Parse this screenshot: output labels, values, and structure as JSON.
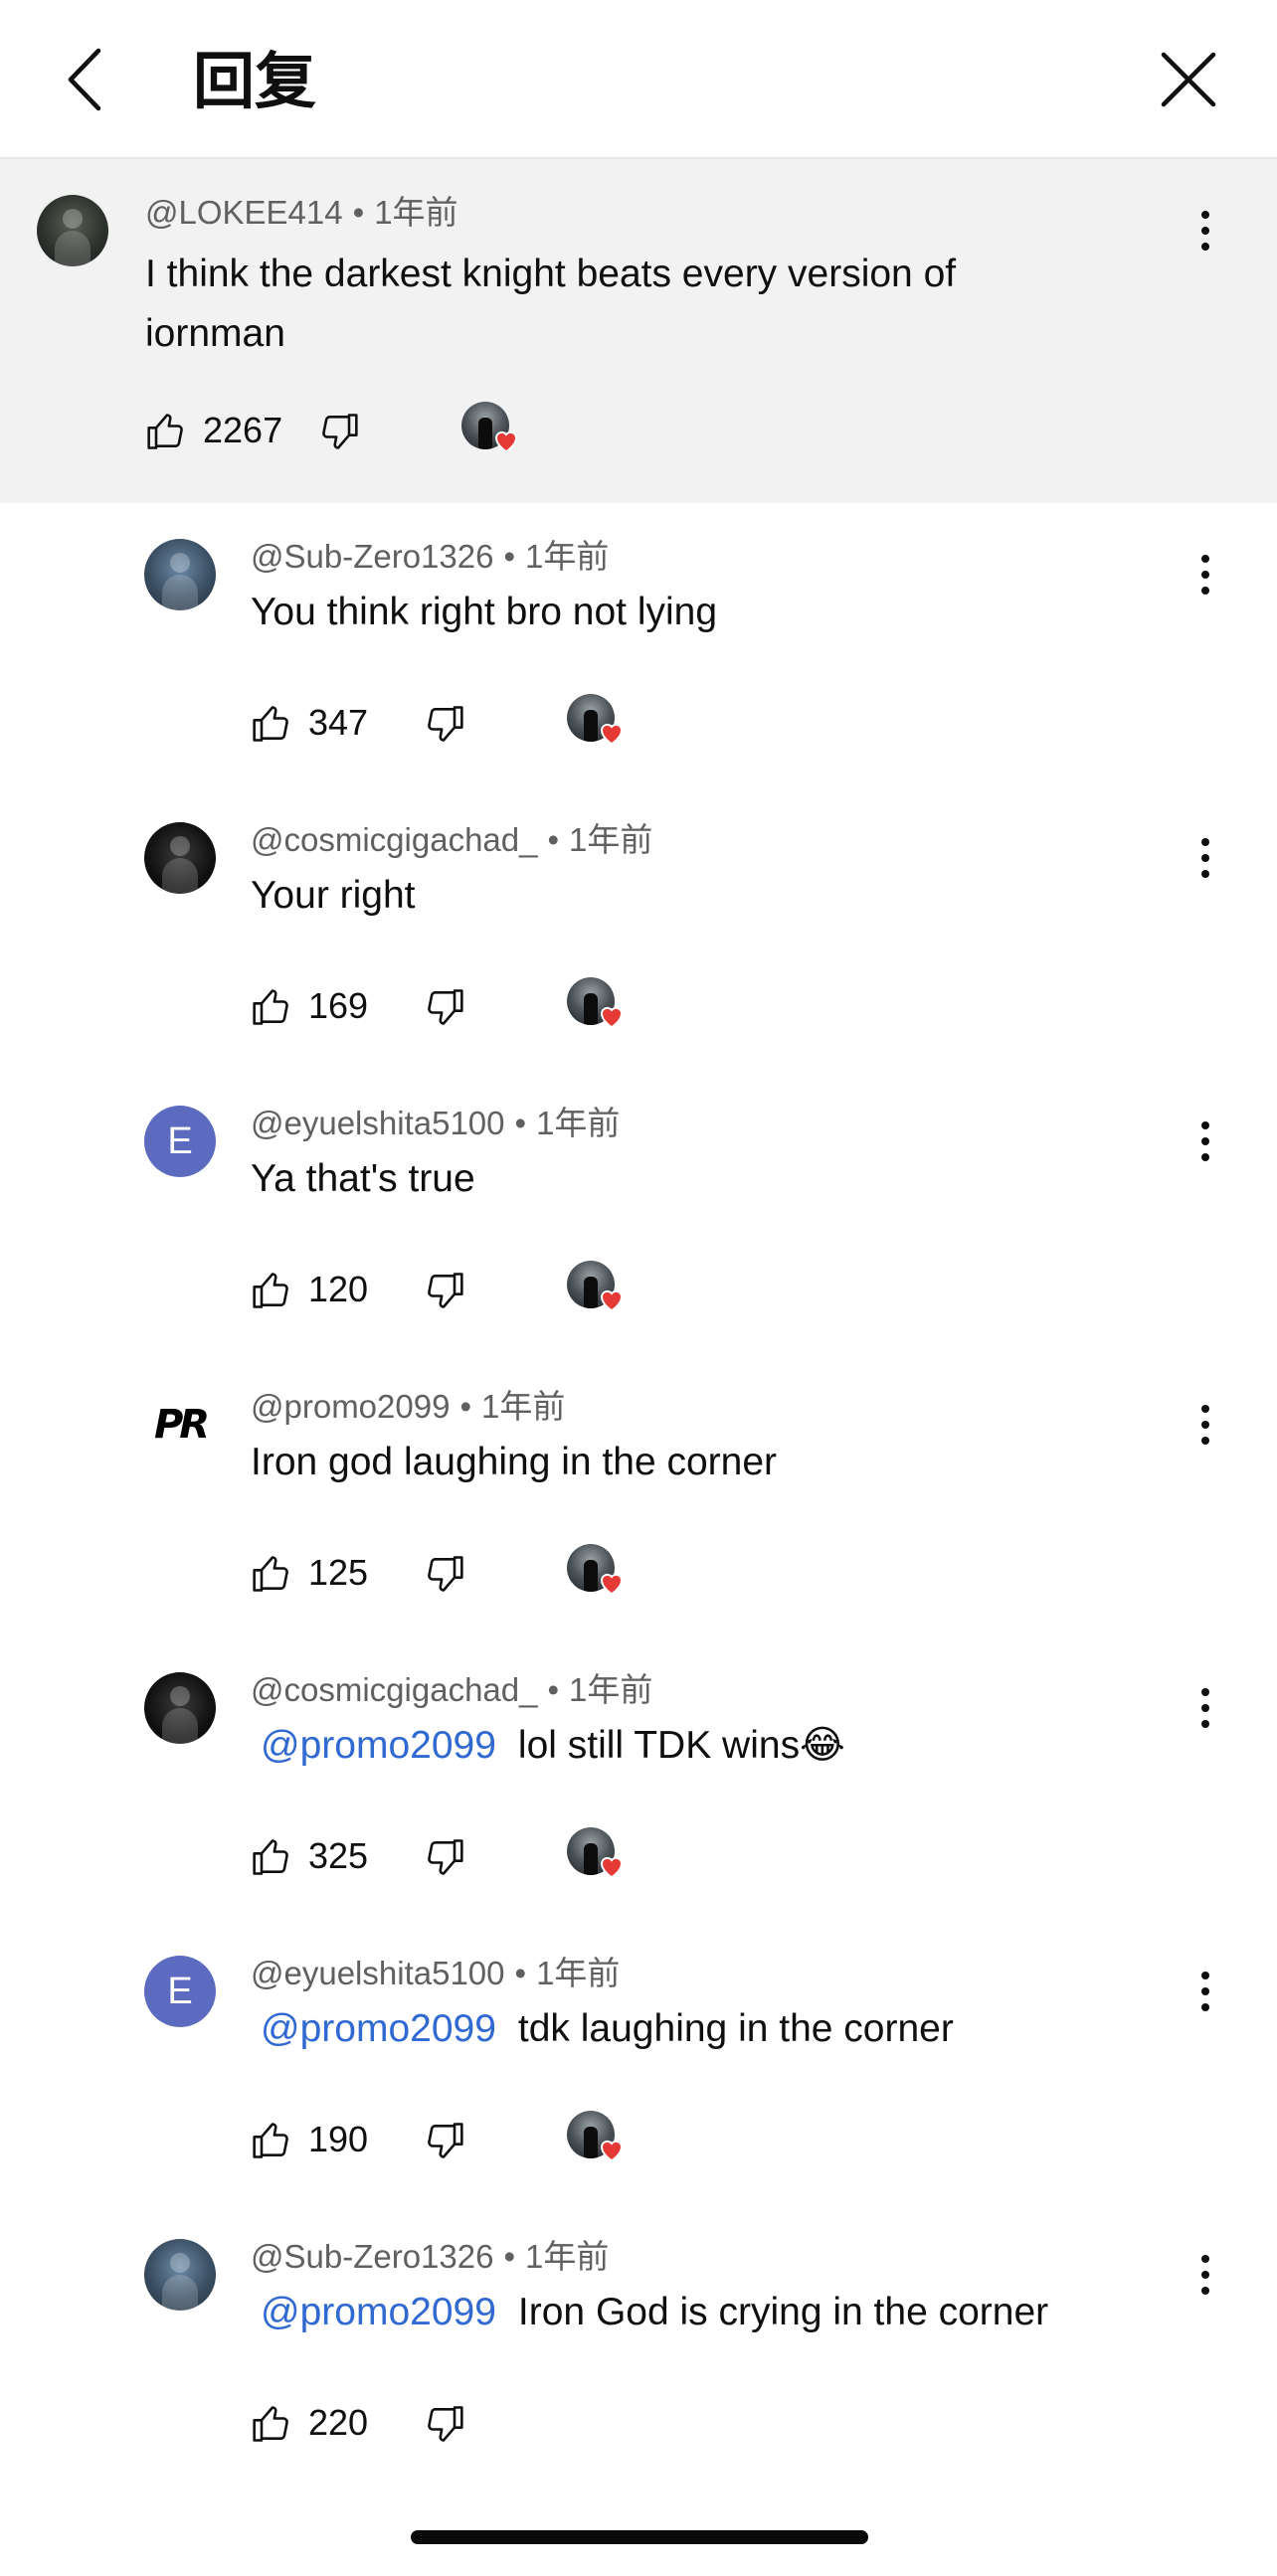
{
  "header": {
    "title": "回复"
  },
  "top_comment": {
    "author": "@LOKEE414",
    "time": "1年前",
    "text": "I think the darkest knight beats every version of iornman",
    "likes": "2267"
  },
  "replies": [
    {
      "author": "@Sub-Zero1326",
      "time": "1年前",
      "mention": "",
      "text": "You think right bro not lying",
      "likes": "347",
      "avatar": "subzero"
    },
    {
      "author": "@cosmicgigachad_",
      "time": "1年前",
      "mention": "",
      "text": "Your right",
      "likes": "169",
      "avatar": "dark"
    },
    {
      "author": "@eyuelshita5100",
      "time": "1年前",
      "mention": "",
      "text": "Ya that's true",
      "likes": "120",
      "avatar": "letter",
      "avatar_letter": "E"
    },
    {
      "author": "@promo2099",
      "time": "1年前",
      "mention": "",
      "text": "Iron god laughing in the corner",
      "likes": "125",
      "avatar": "logo",
      "avatar_text": "PR"
    },
    {
      "author": "@cosmicgigachad_",
      "time": "1年前",
      "mention": "@promo2099",
      "text": "lol still TDK wins😂",
      "likes": "325",
      "avatar": "dark"
    },
    {
      "author": "@eyuelshita5100",
      "time": "1年前",
      "mention": "@promo2099",
      "text": "tdk laughing in the corner",
      "likes": "190",
      "avatar": "letter",
      "avatar_letter": "E"
    },
    {
      "author": "@Sub-Zero1326",
      "time": "1年前",
      "mention": "@promo2099",
      "text": "Iron God is crying in the corner",
      "likes": "220",
      "avatar": "subzero"
    }
  ],
  "dot": "•",
  "icons": {
    "back": "chevron-left-icon",
    "close": "close-icon",
    "like": "thumbs-up-icon",
    "dislike": "thumbs-down-icon",
    "more": "more-vert-icon",
    "creator_heart": "creator-heart-icon"
  },
  "colors": {
    "mention": "#2f69d1",
    "heart": "#e53935",
    "top_bg": "#f2f2f2"
  }
}
